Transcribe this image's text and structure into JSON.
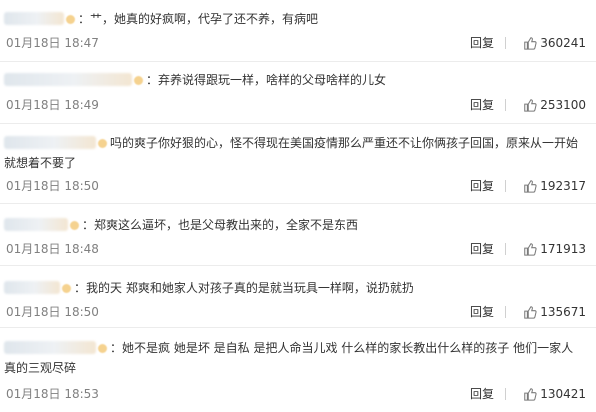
{
  "comments": [
    {
      "separator": "：",
      "text": "艹，她真的好疯啊，代孕了还不养，有病吧",
      "time": "01月18日 18:47",
      "reply_label": "回复",
      "likes": "360241"
    },
    {
      "separator": "：",
      "text": "弃养说得跟玩一样，啥样的父母啥样的儿女",
      "time": "01月18日 18:49",
      "reply_label": "回复",
      "likes": "253100"
    },
    {
      "separator": "",
      "text": "吗的爽子你好狠的心，怪不得现在美国疫情那么严重还不让你俩孩子回国，原来从一开始就想着不要了",
      "time": "01月18日 18:50",
      "reply_label": "回复",
      "likes": "192317"
    },
    {
      "separator": "：",
      "text": "郑爽这么逼坏，也是父母教出来的，全家不是东西",
      "time": "01月18日 18:48",
      "reply_label": "回复",
      "likes": "171913"
    },
    {
      "separator": "：",
      "text": "我的天 郑爽和她家人对孩子真的是就当玩具一样啊，说扔就扔",
      "time": "01月18日 18:50",
      "reply_label": "回复",
      "likes": "135671"
    },
    {
      "separator": "：",
      "text": "她不是疯 她是坏 是自私 是把人命当儿戏 什么样的家长教出什么样的孩子 他们一家人真的三观尽碎",
      "time": "01月18日 18:53",
      "reply_label": "回复",
      "likes": "130421"
    }
  ],
  "icons": {
    "like": "thumbs-up-icon"
  },
  "colors": {
    "meta_text": "#808080",
    "body_text": "#333333",
    "divider": "#ececec"
  }
}
